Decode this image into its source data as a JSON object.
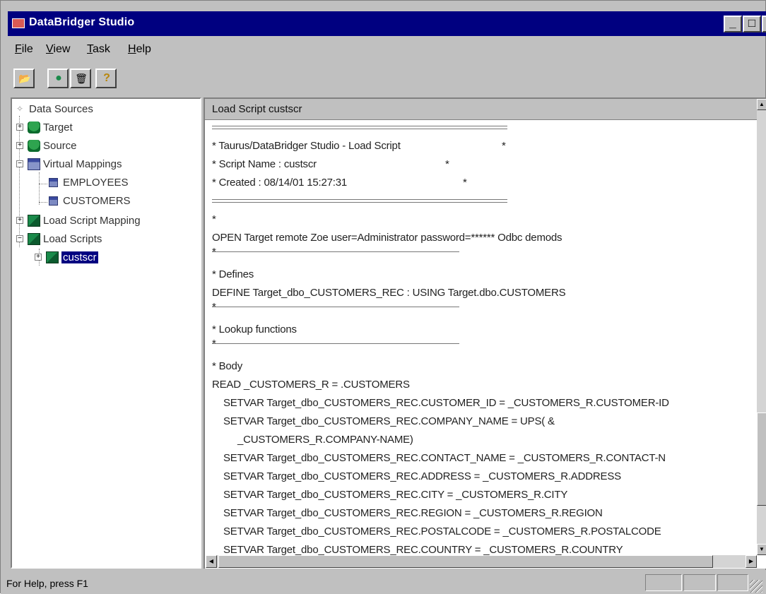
{
  "window": {
    "title": "DataBridger Studio",
    "controls": {
      "minimize": "_",
      "maximize": "□",
      "close": "×"
    }
  },
  "menu": {
    "items": [
      "File",
      "View",
      "Task",
      "Help"
    ]
  },
  "toolbar": {
    "buttons": [
      {
        "icon": "open-folder-icon",
        "glyph": "📂"
      },
      {
        "icon": "database-icon",
        "glyph": "●"
      },
      {
        "icon": "trash-icon",
        "glyph": "🗑"
      },
      {
        "icon": "help-icon",
        "glyph": "?"
      }
    ]
  },
  "tree": {
    "items": [
      {
        "label": "Data Sources",
        "level": 0,
        "expander": "",
        "icon": "data-sources-icon"
      },
      {
        "label": "Target",
        "level": 1,
        "expander": "+",
        "icon": "database-icon"
      },
      {
        "label": "Source",
        "level": 1,
        "expander": "+",
        "icon": "database-icon"
      },
      {
        "label": "Virtual Mappings",
        "level": 1,
        "expander": "−",
        "icon": "table-icon"
      },
      {
        "label": "EMPLOYEES",
        "level": 2,
        "expander": "",
        "icon": "table-icon"
      },
      {
        "label": "CUSTOMERS",
        "level": 2,
        "expander": "",
        "icon": "table-icon"
      },
      {
        "label": "Load Script Mapping",
        "level": 1,
        "expander": "+",
        "icon": "script-icon"
      },
      {
        "label": "Load Scripts",
        "level": 1,
        "expander": "−",
        "icon": "script-icon"
      },
      {
        "label": "custscr",
        "level": 2,
        "expander": "+",
        "icon": "script-icon",
        "selected": true
      }
    ]
  },
  "script_pane": {
    "header": "Load Script custscr",
    "lines": [
      {
        "type": "stars"
      },
      {
        "type": "text",
        "text": "* Taurus/DataBridger Studio - Load Script",
        "trail": "*"
      },
      {
        "type": "text",
        "text": "* Script Name : custscr",
        "trail": "*"
      },
      {
        "type": "text",
        "text": "* Created    : 08/14/01 15:27:31",
        "trail": "*"
      },
      {
        "type": "stars"
      },
      {
        "type": "text",
        "text": "*"
      },
      {
        "type": "text",
        "text": "OPEN Target remote Zoe user=Administrator password=****** Odbc demods"
      },
      {
        "type": "dash"
      },
      {
        "type": "text",
        "text": "* Defines"
      },
      {
        "type": "text",
        "text": "DEFINE Target_dbo_CUSTOMERS_REC : USING Target.dbo.CUSTOMERS"
      },
      {
        "type": "dash"
      },
      {
        "type": "text",
        "text": "* Lookup functions"
      },
      {
        "type": "dash"
      },
      {
        "type": "text",
        "text": "* Body"
      },
      {
        "type": "text",
        "text": "READ _CUSTOMERS_R = .CUSTOMERS"
      },
      {
        "type": "text",
        "indent": 1,
        "text": "SETVAR Target_dbo_CUSTOMERS_REC.CUSTOMER_ID = _CUSTOMERS_R.CUSTOMER-ID"
      },
      {
        "type": "text",
        "indent": 1,
        "text": "SETVAR Target_dbo_CUSTOMERS_REC.COMPANY_NAME = UPS( &"
      },
      {
        "type": "text",
        "indent": 2,
        "text": "_CUSTOMERS_R.COMPANY-NAME)"
      },
      {
        "type": "text",
        "indent": 1,
        "text": "SETVAR Target_dbo_CUSTOMERS_REC.CONTACT_NAME = _CUSTOMERS_R.CONTACT-N"
      },
      {
        "type": "text",
        "indent": 1,
        "text": "SETVAR Target_dbo_CUSTOMERS_REC.ADDRESS = _CUSTOMERS_R.ADDRESS"
      },
      {
        "type": "text",
        "indent": 1,
        "text": "SETVAR Target_dbo_CUSTOMERS_REC.CITY = _CUSTOMERS_R.CITY"
      },
      {
        "type": "text",
        "indent": 1,
        "text": "SETVAR Target_dbo_CUSTOMERS_REC.REGION = _CUSTOMERS_R.REGION"
      },
      {
        "type": "text",
        "indent": 1,
        "text": "SETVAR Target_dbo_CUSTOMERS_REC.POSTALCODE = _CUSTOMERS_R.POSTALCODE"
      },
      {
        "type": "text",
        "indent": 1,
        "text": "SETVAR Target_dbo_CUSTOMERS_REC.COUNTRY = _CUSTOMERS_R.COUNTRY"
      }
    ]
  },
  "status": {
    "text": "For Help, press F1"
  },
  "colors": {
    "titlebar": "#000080",
    "chrome": "#c0c0c0",
    "selection": "#000080"
  }
}
